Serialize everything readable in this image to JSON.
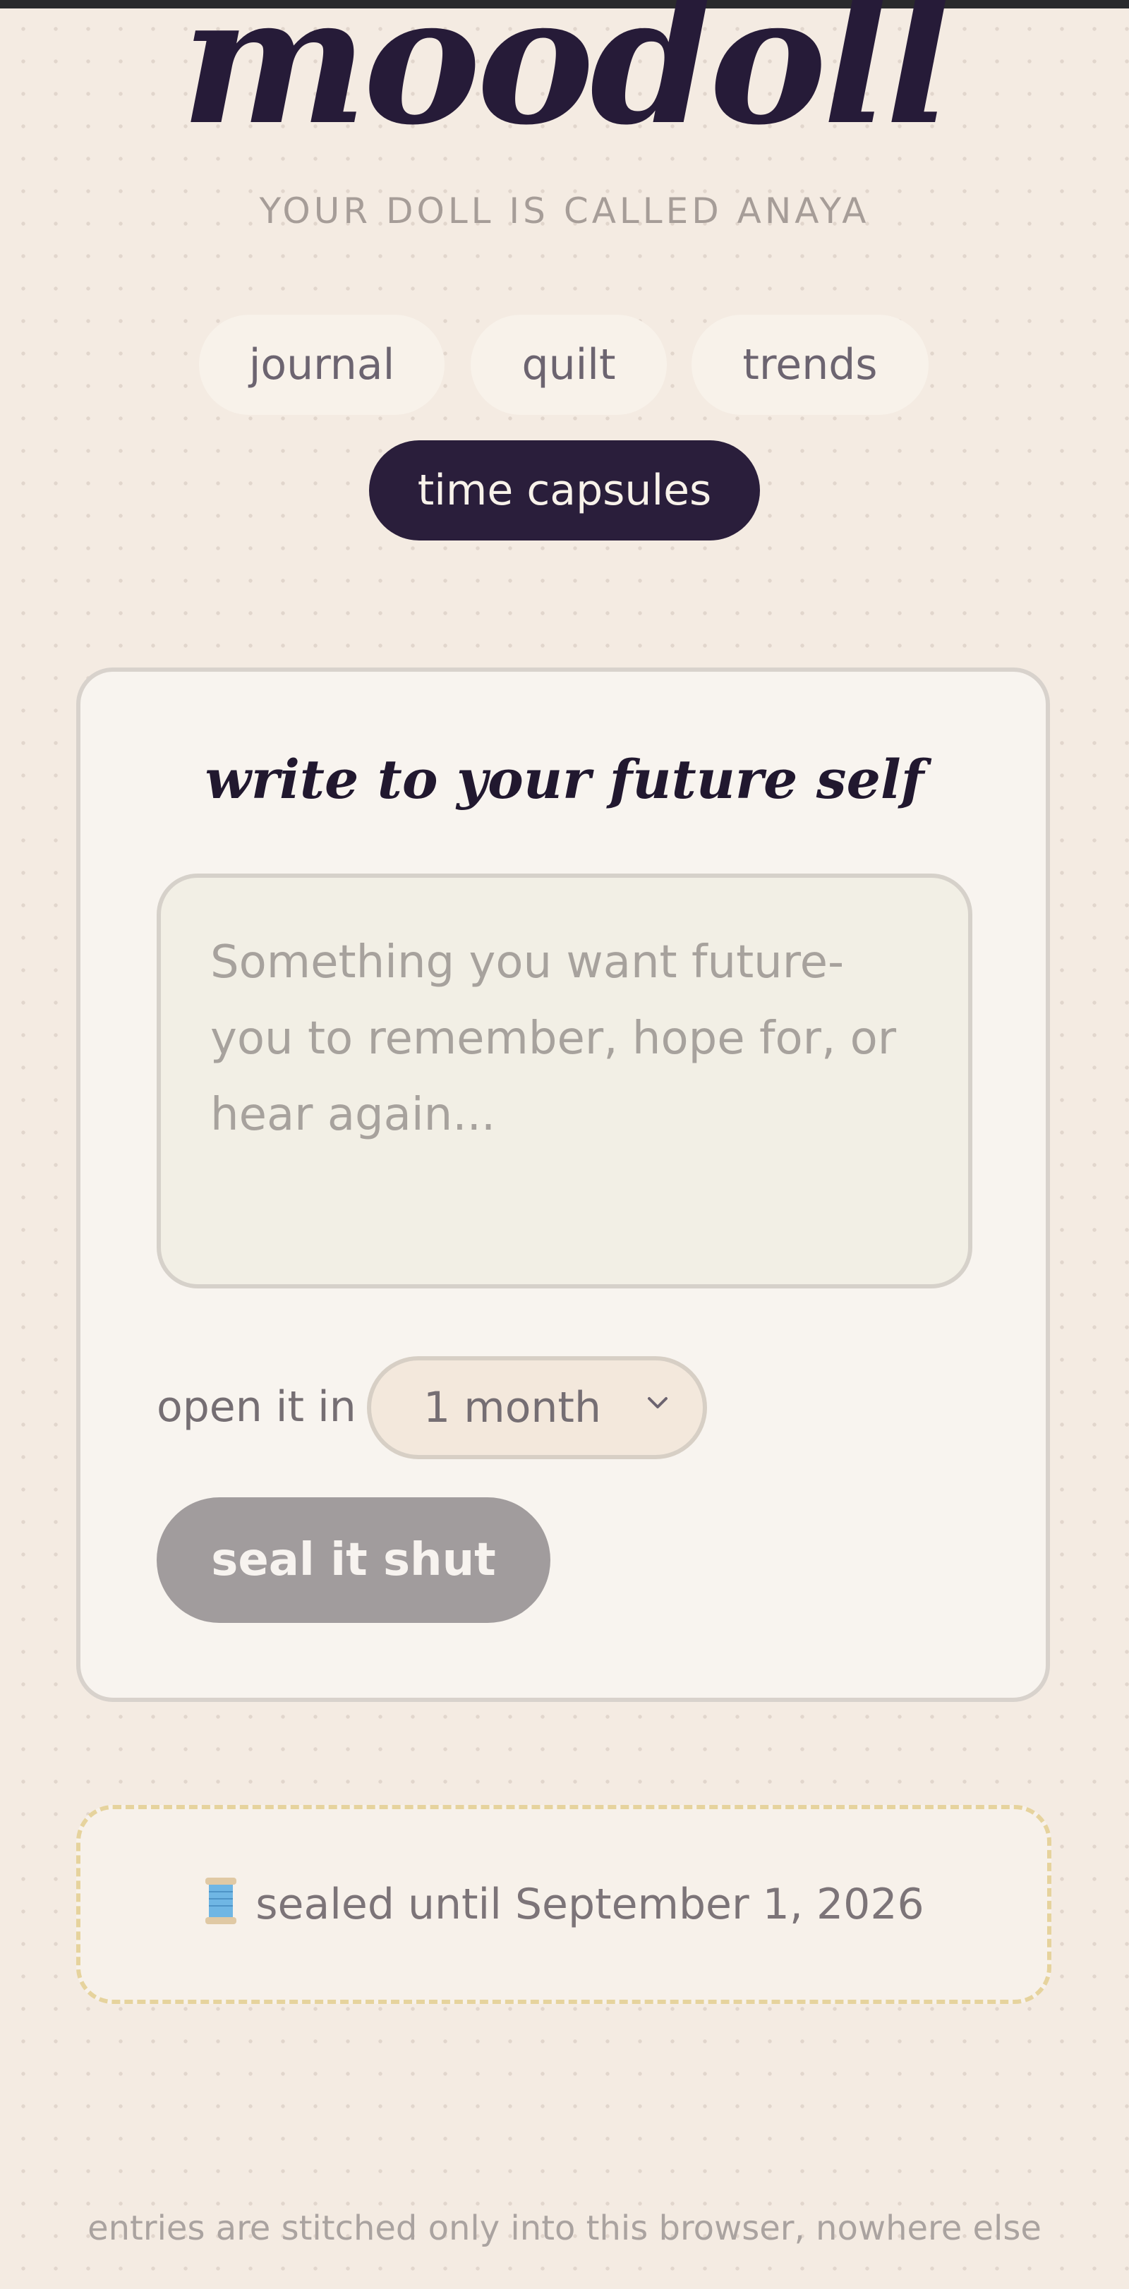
{
  "app": {
    "logo": "moodoll",
    "subtitle": "YOUR DOLL IS CALLED ANAYA"
  },
  "nav": {
    "tabs": [
      {
        "label": "journal",
        "active": false
      },
      {
        "label": "quilt",
        "active": false
      },
      {
        "label": "trends",
        "active": false
      },
      {
        "label": "time capsules",
        "active": true
      }
    ]
  },
  "capsule_form": {
    "title": "write to your future self",
    "message_placeholder": "Something you want future-you to remember, hope for, or hear again...",
    "message_value": "",
    "open_label": "open it in",
    "open_select": {
      "selected": "1 month"
    },
    "seal_button_label": "seal it shut"
  },
  "sealed_capsules": [
    {
      "icon": "thread-spool-icon",
      "text": "sealed until September 1, 2026"
    }
  ],
  "footer": {
    "note": "entries are stitched only into this browser, nowhere else"
  },
  "colors": {
    "background": "#f4ebe2",
    "ink": "#261b38",
    "active_tab": "#2a1e3b",
    "button_disabled": "#a19c9d",
    "dashed_border": "#e6d39d"
  }
}
